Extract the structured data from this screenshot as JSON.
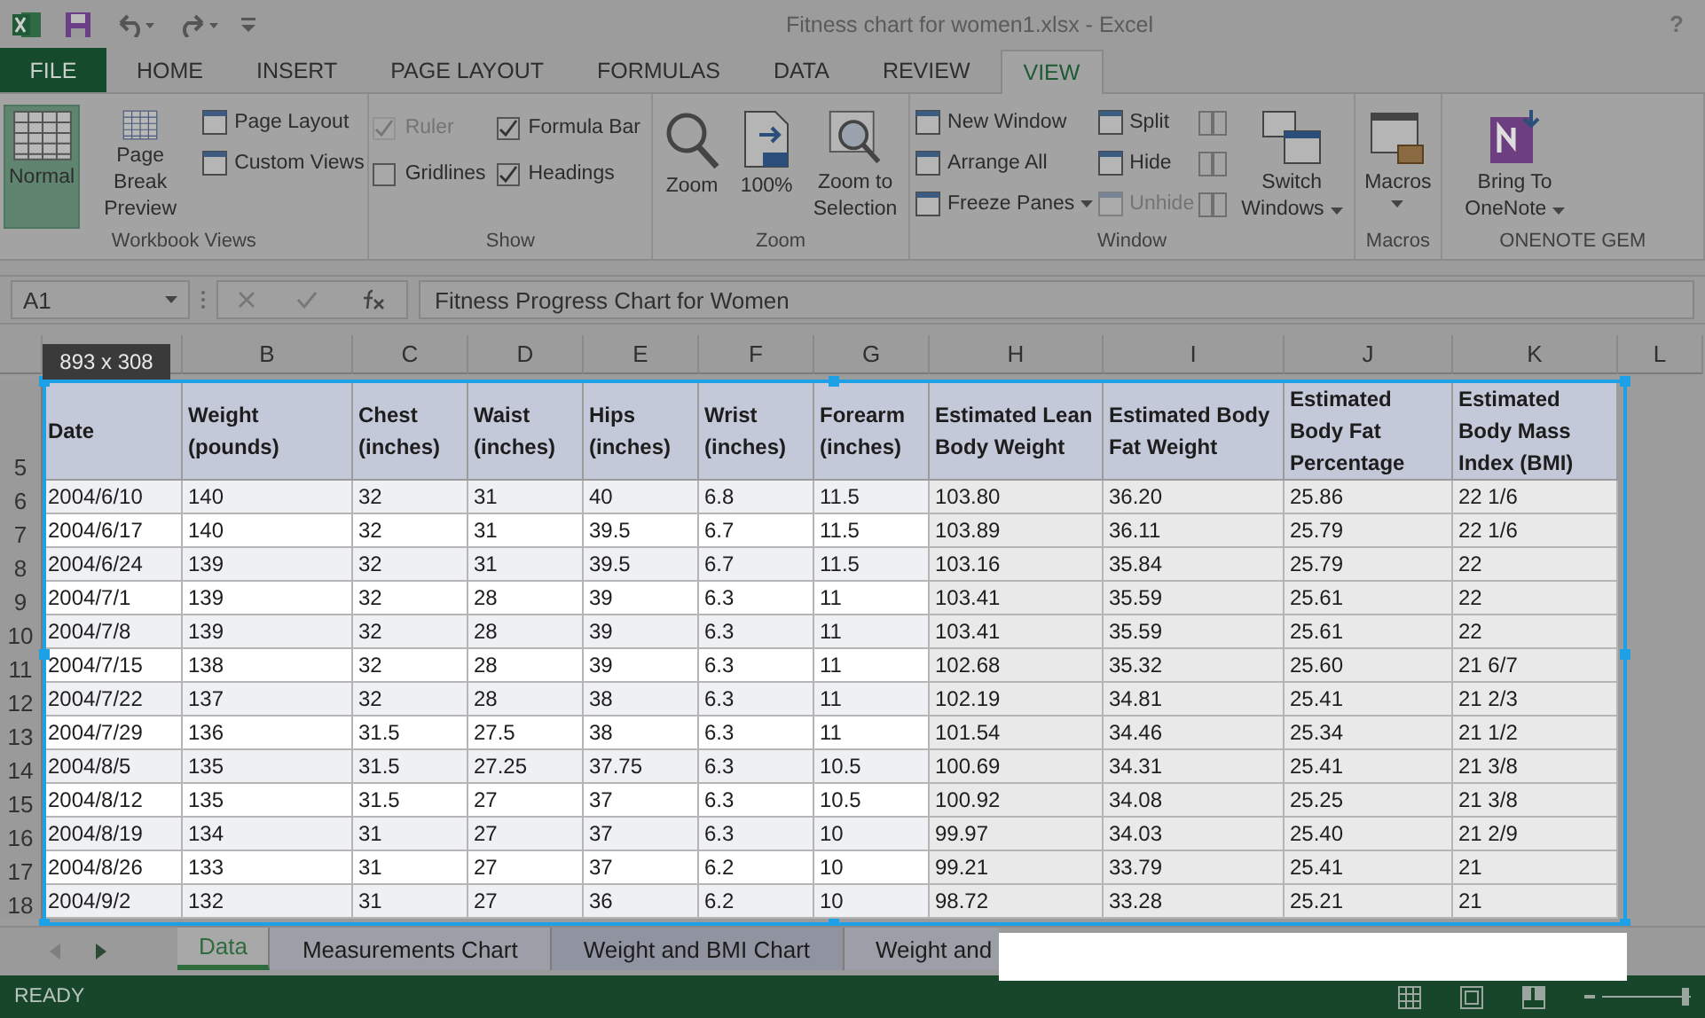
{
  "title_bar": {
    "title": "Fitness chart for women1.xlsx - Excel",
    "help": "?"
  },
  "ribbon_tabs": [
    {
      "label": "FILE",
      "kind": "file",
      "selected": false
    },
    {
      "label": "HOME",
      "kind": "tab",
      "selected": false
    },
    {
      "label": "INSERT",
      "kind": "tab",
      "selected": false
    },
    {
      "label": "PAGE LAYOUT",
      "kind": "tab",
      "selected": false
    },
    {
      "label": "FORMULAS",
      "kind": "tab",
      "selected": false
    },
    {
      "label": "DATA",
      "kind": "tab",
      "selected": false
    },
    {
      "label": "REVIEW",
      "kind": "tab",
      "selected": false
    },
    {
      "label": "VIEW",
      "kind": "tab",
      "selected": true
    }
  ],
  "ribbon_groups": [
    {
      "label": "Workbook Views",
      "columns": [
        [
          {
            "kind": "large",
            "label": "Normal",
            "selected": true
          }
        ],
        [
          {
            "kind": "large",
            "label": "Page Break Preview",
            "selected": false
          }
        ],
        [
          {
            "kind": "small",
            "label": "Page Layout"
          },
          {
            "kind": "small",
            "label": "Custom Views"
          }
        ]
      ]
    },
    {
      "label": "Show",
      "columns": [
        [
          {
            "kind": "check",
            "label": "Ruler",
            "checked": true,
            "disabled": true
          },
          {
            "kind": "check",
            "label": "Gridlines",
            "checked": false,
            "disabled": false
          }
        ],
        [
          {
            "kind": "check",
            "label": "Formula Bar",
            "checked": true,
            "disabled": false
          },
          {
            "kind": "check",
            "label": "Headings",
            "checked": true,
            "disabled": false
          }
        ]
      ]
    },
    {
      "label": "Zoom",
      "columns": [
        [
          {
            "kind": "large",
            "label": "Zoom"
          }
        ],
        [
          {
            "kind": "large",
            "label": "100%"
          }
        ],
        [
          {
            "kind": "large",
            "label": "Zoom to Selection"
          }
        ]
      ]
    },
    {
      "label": "Window",
      "columns": [
        [
          {
            "kind": "small",
            "label": "New Window",
            "disabled": false
          },
          {
            "kind": "small",
            "label": "Arrange All",
            "disabled": false
          },
          {
            "kind": "small",
            "label": "Freeze Panes",
            "dropdown": true,
            "disabled": false
          }
        ],
        [
          {
            "kind": "small",
            "label": "Split",
            "disabled": false
          },
          {
            "kind": "small",
            "label": "Hide",
            "disabled": false
          },
          {
            "kind": "small",
            "label": "Unhide",
            "disabled": true
          }
        ],
        [
          {
            "kind": "icon",
            "disabled": true
          },
          {
            "kind": "icon",
            "disabled": true
          },
          {
            "kind": "icon",
            "disabled": true
          }
        ],
        [
          {
            "kind": "large",
            "label": "Switch Windows",
            "dropdown": true
          }
        ]
      ]
    },
    {
      "label": "Macros",
      "columns": [
        [
          {
            "kind": "large",
            "label": "Macros",
            "dropdown": true
          }
        ]
      ]
    },
    {
      "label": "ONENOTE GEM",
      "columns": [
        [
          {
            "kind": "large",
            "label": "Bring To OneNote",
            "dropdown": true
          }
        ]
      ]
    }
  ],
  "formula_bar": {
    "name_box": "A1",
    "formula": "Fitness Progress Chart for Women"
  },
  "sheet": {
    "columns": [
      "B",
      "C",
      "D",
      "E",
      "F",
      "G",
      "H",
      "I",
      "J",
      "K",
      "L"
    ],
    "size_tooltip": "893 x 308",
    "header_row": {
      "number": "5",
      "cells": [
        "Date",
        "Weight (pounds)",
        "Chest (inches)",
        "Waist (inches)",
        "Hips (inches)",
        "Wrist (inches)",
        "Forearm (inches)",
        "Estimated Lean Body Weight",
        "Estimated Body Fat Weight",
        "Estimated Body Fat Percentage",
        "Estimated Body Mass Index (BMI)"
      ]
    },
    "rows": [
      {
        "number": "6",
        "cells": [
          "2004/6/10",
          "140",
          "32",
          "31",
          "40",
          "6.8",
          "11.5",
          "103.80",
          "36.20",
          "25.86",
          "22 1/6"
        ]
      },
      {
        "number": "7",
        "cells": [
          "2004/6/17",
          "140",
          "32",
          "31",
          "39.5",
          "6.7",
          "11.5",
          "103.89",
          "36.11",
          "25.79",
          "22 1/6"
        ]
      },
      {
        "number": "8",
        "cells": [
          "2004/6/24",
          "139",
          "32",
          "31",
          "39.5",
          "6.7",
          "11.5",
          "103.16",
          "35.84",
          "25.79",
          "22"
        ]
      },
      {
        "number": "9",
        "cells": [
          "2004/7/1",
          "139",
          "32",
          "28",
          "39",
          "6.3",
          "11",
          "103.41",
          "35.59",
          "25.61",
          "22"
        ]
      },
      {
        "number": "10",
        "cells": [
          "2004/7/8",
          "139",
          "32",
          "28",
          "39",
          "6.3",
          "11",
          "103.41",
          "35.59",
          "25.61",
          "22"
        ]
      },
      {
        "number": "11",
        "cells": [
          "2004/7/15",
          "138",
          "32",
          "28",
          "39",
          "6.3",
          "11",
          "102.68",
          "35.32",
          "25.60",
          "21 6/7"
        ]
      },
      {
        "number": "12",
        "cells": [
          "2004/7/22",
          "137",
          "32",
          "28",
          "38",
          "6.3",
          "11",
          "102.19",
          "34.81",
          "25.41",
          "21 2/3"
        ]
      },
      {
        "number": "13",
        "cells": [
          "2004/7/29",
          "136",
          "31.5",
          "27.5",
          "38",
          "6.3",
          "11",
          "101.54",
          "34.46",
          "25.34",
          "21 1/2"
        ]
      },
      {
        "number": "14",
        "cells": [
          "2004/8/5",
          "135",
          "31.5",
          "27.25",
          "37.75",
          "6.3",
          "10.5",
          "100.69",
          "34.31",
          "25.41",
          "21 3/8"
        ]
      },
      {
        "number": "15",
        "cells": [
          "2004/8/12",
          "135",
          "31.5",
          "27",
          "37",
          "6.3",
          "10.5",
          "100.92",
          "34.08",
          "25.25",
          "21 3/8"
        ]
      },
      {
        "number": "16",
        "cells": [
          "2004/8/19",
          "134",
          "31",
          "27",
          "37",
          "6.3",
          "10",
          "99.97",
          "34.03",
          "25.40",
          "21 2/9"
        ]
      },
      {
        "number": "17",
        "cells": [
          "2004/8/26",
          "133",
          "31",
          "27",
          "37",
          "6.2",
          "10",
          "99.21",
          "33.79",
          "25.41",
          "21"
        ]
      },
      {
        "number": "18",
        "cells": [
          "2004/9/2",
          "132",
          "31",
          "27",
          "36",
          "6.2",
          "10",
          "98.72",
          "33.28",
          "25.21",
          "21"
        ]
      }
    ]
  },
  "sheet_tabs": [
    {
      "label": "Data",
      "selected": true
    },
    {
      "label": "Measurements Chart",
      "selected": false
    },
    {
      "label": "Weight and BMI Chart",
      "selected": false
    },
    {
      "label": "Weight and",
      "selected": false
    }
  ],
  "status_bar": {
    "status": "READY"
  }
}
